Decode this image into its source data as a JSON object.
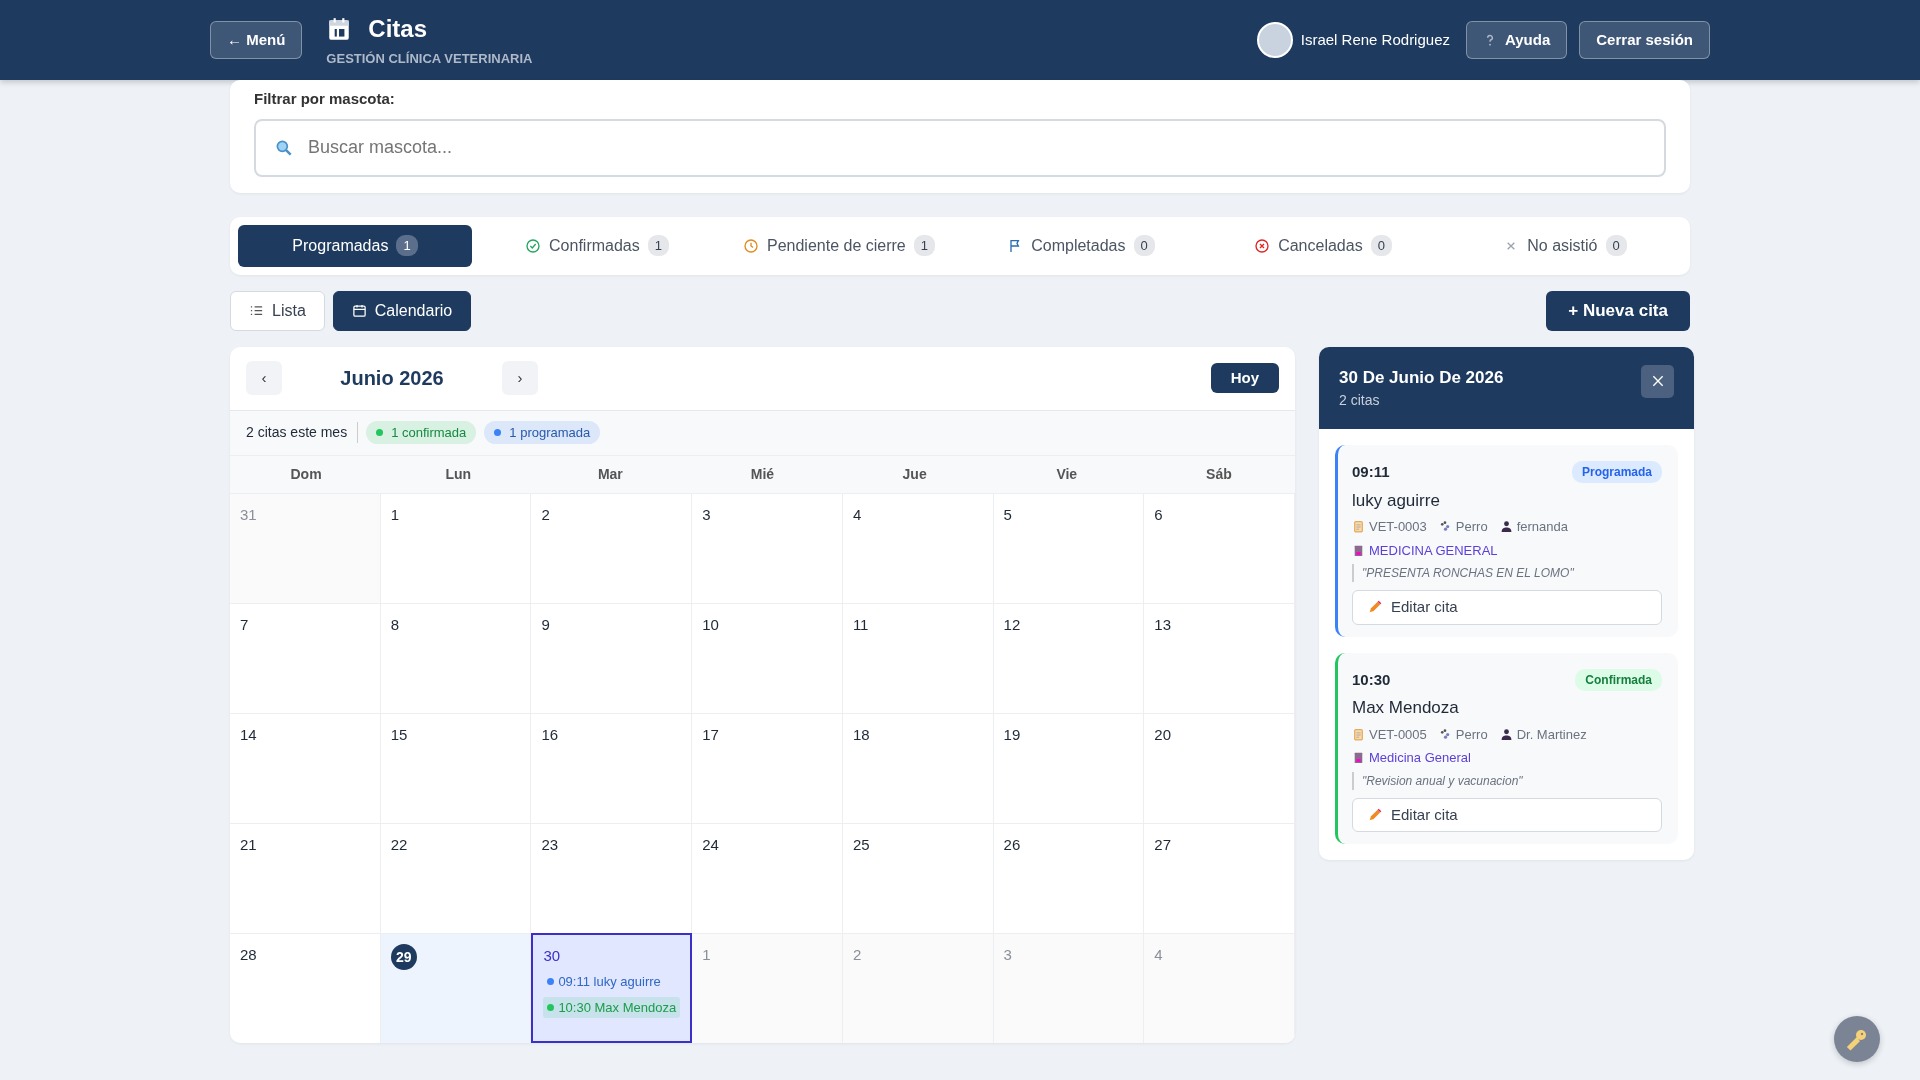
{
  "header": {
    "menu_button": "← Menú",
    "title": "Citas",
    "subtitle": "GESTIÓN CLÍNICA VETERINARIA",
    "user": "Israel Rene Rodriguez",
    "help_button": "Ayuda",
    "logout_button": "Cerrar sesión"
  },
  "filter": {
    "label": "Filtrar por mascota:",
    "placeholder": "Buscar mascota..."
  },
  "status_tabs": [
    {
      "kind": "scheduled",
      "label": "Programadas",
      "count": "1",
      "selected": true
    },
    {
      "kind": "confirmed",
      "label": "Confirmadas",
      "count": "1",
      "selected": false
    },
    {
      "kind": "pending",
      "label": "Pendiente de cierre",
      "count": "1",
      "selected": false
    },
    {
      "kind": "completed",
      "label": "Completadas",
      "count": "0",
      "selected": false
    },
    {
      "kind": "cancelled",
      "label": "Canceladas",
      "count": "0",
      "selected": false
    },
    {
      "kind": "noshow",
      "label": "No asistió",
      "count": "0",
      "selected": false
    }
  ],
  "views": [
    {
      "kind": "list",
      "label": "Lista",
      "selected": false
    },
    {
      "kind": "calendar",
      "label": "Calendario",
      "selected": true
    }
  ],
  "new_button": "+ Nueva cita",
  "calendar": {
    "prev": "‹",
    "month": "Junio 2026",
    "next": "›",
    "today_button": "Hoy",
    "summary": "2 citas este mes",
    "legend": [
      {
        "label": "1 confirmada",
        "color": "#22c55e"
      },
      {
        "label": "1 programada",
        "color": "#3b82f6"
      }
    ],
    "weekdays": [
      "Dom",
      "Lun",
      "Mar",
      "Mié",
      "Jue",
      "Vie",
      "Sáb"
    ],
    "weeks": [
      [
        {
          "day": "31",
          "outside": true
        },
        {
          "day": "1",
          "outside": false
        },
        {
          "day": "2",
          "outside": false
        },
        {
          "day": "3",
          "outside": false
        },
        {
          "day": "4",
          "outside": false
        },
        {
          "day": "5",
          "outside": false
        },
        {
          "day": "6",
          "outside": false
        }
      ],
      [
        {
          "day": "7",
          "outside": false
        },
        {
          "day": "8",
          "outside": false
        },
        {
          "day": "9",
          "outside": false
        },
        {
          "day": "10",
          "outside": false
        },
        {
          "day": "11",
          "outside": false
        },
        {
          "day": "12",
          "outside": false
        },
        {
          "day": "13",
          "outside": false
        }
      ],
      [
        {
          "day": "14",
          "outside": false
        },
        {
          "day": "15",
          "outside": false
        },
        {
          "day": "16",
          "outside": false
        },
        {
          "day": "17",
          "outside": false
        },
        {
          "day": "18",
          "outside": false
        },
        {
          "day": "19",
          "outside": false
        },
        {
          "day": "20",
          "outside": false
        }
      ],
      [
        {
          "day": "21",
          "outside": false
        },
        {
          "day": "22",
          "outside": false
        },
        {
          "day": "23",
          "outside": false
        },
        {
          "day": "24",
          "outside": false
        },
        {
          "day": "25",
          "outside": false
        },
        {
          "day": "26",
          "outside": false
        },
        {
          "day": "27",
          "outside": false
        }
      ],
      [
        {
          "day": "28",
          "outside": false
        },
        {
          "day": "29",
          "outside": false,
          "today": true
        },
        {
          "day": "30",
          "outside": false,
          "selected": true,
          "events": [
            {
              "text": "09:11 luky aguirre",
              "color": "#3b82f6"
            },
            {
              "text": "10:30 Max Mendoza",
              "color": "#22c55e"
            }
          ]
        },
        {
          "day": "1",
          "outside": true
        },
        {
          "day": "2",
          "outside": true
        },
        {
          "day": "3",
          "outside": true
        },
        {
          "day": "4",
          "outside": true
        }
      ]
    ]
  },
  "day_panel": {
    "title": "30 De Junio De 2026",
    "subtitle": "2 citas",
    "appointments": [
      {
        "kind": "scheduled",
        "time": "09:11",
        "status": "Programada",
        "pet": "luky aguirre",
        "code": "VET-0003",
        "species": "Perro",
        "person": "fernanda",
        "service": "MEDICINA GENERAL",
        "note": "\"PRESENTA RONCHAS EN EL LOMO\"",
        "edit_button": "Editar cita"
      },
      {
        "kind": "confirmed",
        "time": "10:30",
        "status": "Confirmada",
        "pet": "Max Mendoza",
        "code": "VET-0005",
        "species": "Perro",
        "person": "Dr. Martinez",
        "service": "Medicina General",
        "note": "\"Revision anual y vacunacion\"",
        "edit_button": "Editar cita"
      }
    ]
  }
}
